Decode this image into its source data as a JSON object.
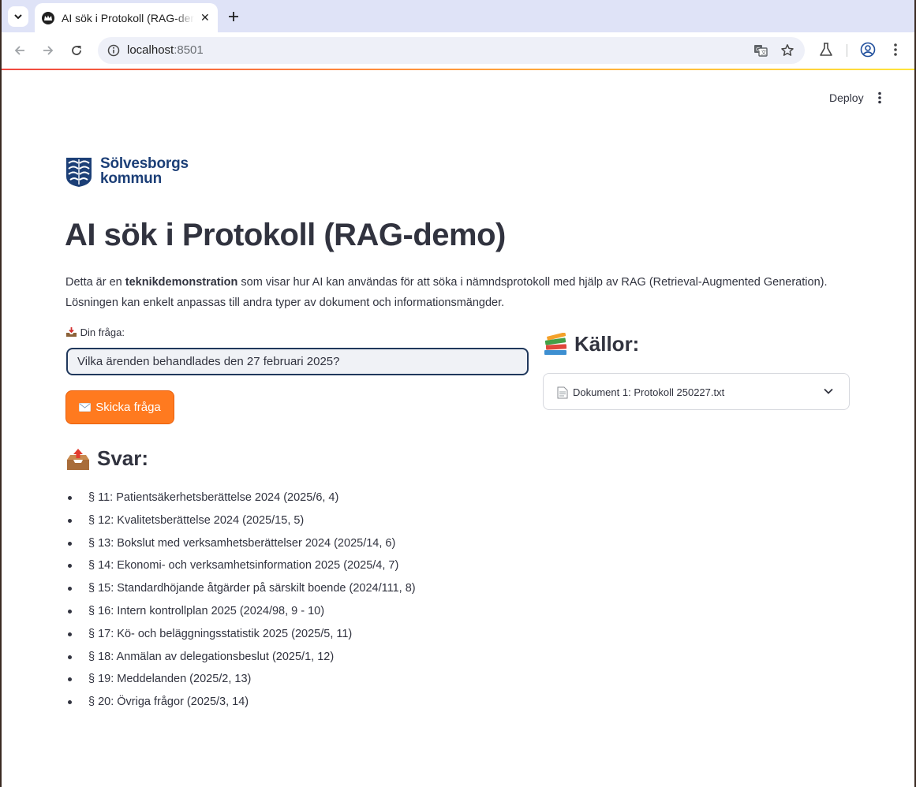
{
  "browser": {
    "tab_title": "AI sök i Protokoll (RAG-demo)",
    "url_host": "localhost",
    "url_port": ":8501"
  },
  "app": {
    "deploy_label": "Deploy",
    "logo": {
      "line1": "Sölvesborgs",
      "line2": "kommun",
      "brand_color": "#1c3f77"
    },
    "title": "AI sök i Protokoll (RAG-demo)",
    "intro": {
      "part1": "Detta är en ",
      "bold": "teknikdemonstration",
      "part2": " som visar hur AI kan användas för att söka i nämndsprotokoll med hjälp av RAG (Retrieval-Augmented Generation). Lösningen kan enkelt anpassas till andra typer av dokument och informationsmängder."
    },
    "query": {
      "label": "Din fråga:",
      "label_icon": "inbox-tray-icon",
      "value": "Vilka ärenden behandlades den 27 februari 2025?"
    },
    "submit": {
      "label": "Skicka fråga",
      "icon": "envelope-icon",
      "color": "#ff7a1f"
    },
    "answer": {
      "heading": "Svar:",
      "heading_icon": "outbox-tray-icon",
      "items": [
        "§ 11: Patientsäkerhetsberättelse 2024 (2025/6, 4)",
        "§ 12: Kvalitetsberättelse 2024 (2025/15, 5)",
        "§ 13: Bokslut med verksamhetsberättelser 2024 (2025/14, 6)",
        "§ 14: Ekonomi- och verksamhetsinformation 2025 (2025/4, 7)",
        "§ 15: Standardhöjande åtgärder på särskilt boende (2024/111, 8)",
        "§ 16: Intern kontrollplan 2025 (2024/98, 9 - 10)",
        "§ 17: Kö- och beläggningsstatistik 2025 (2025/5, 11)",
        "§ 18: Anmälan av delegationsbeslut (2025/1, 12)",
        "§ 19: Meddelanden (2025/2, 13)",
        "§ 20: Övriga frågor (2025/3, 14)"
      ]
    },
    "sources": {
      "heading": "Källor:",
      "heading_icon": "books-icon",
      "expander_label": "Dokument 1: Protokoll 250227.txt",
      "expander_icon": "page-icon"
    }
  }
}
